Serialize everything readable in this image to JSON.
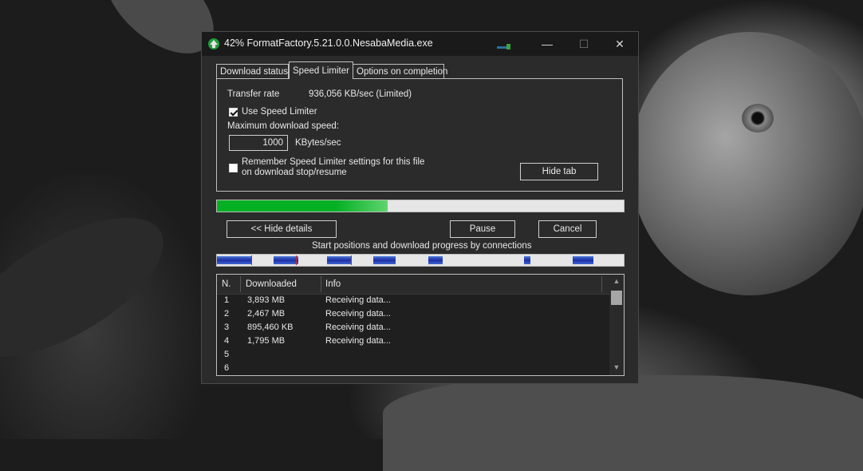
{
  "window": {
    "title": "42% FormatFactory.5.21.0.0.NesabaMedia.exe",
    "controls": {
      "minimize": "—",
      "maximize": "☐",
      "close": "✕"
    }
  },
  "tabs": [
    {
      "label": "Download status",
      "active": false
    },
    {
      "label": "Speed Limiter",
      "active": true
    },
    {
      "label": "Options on completion",
      "active": false
    }
  ],
  "speed_limiter": {
    "transfer_rate_label": "Transfer rate",
    "transfer_rate_value": "936,056  KB/sec  (Limited)",
    "use_limiter_label": "Use Speed Limiter",
    "use_limiter_checked": true,
    "max_speed_label": "Maximum download speed:",
    "max_speed_value": "1000",
    "max_speed_unit": "KBytes/sec",
    "remember_label_line1": "Remember Speed Limiter settings for this file",
    "remember_label_line2": "on download stop/resume",
    "remember_checked": false,
    "hide_tab_button": "Hide tab"
  },
  "progress": {
    "percent": 42,
    "color": "#06b025"
  },
  "buttons": {
    "hide_details": "<< Hide details",
    "pause": "Pause",
    "cancel": "Cancel"
  },
  "connections_title": "Start positions and download progress by connections",
  "connections_bar": {
    "segments": [
      [
        0.0,
        0.085
      ],
      [
        0.14,
        0.2
      ],
      [
        0.27,
        0.33
      ],
      [
        0.385,
        0.44
      ],
      [
        0.52,
        0.555
      ],
      [
        0.755,
        0.77
      ],
      [
        0.875,
        0.925
      ]
    ],
    "markers": [
      0.085,
      0.195,
      0.33
    ]
  },
  "list": {
    "headers": {
      "n": "N.",
      "downloaded": "Downloaded",
      "info": "Info"
    },
    "rows": [
      {
        "n": "1",
        "downloaded": "3,893  MB",
        "info": "Receiving data..."
      },
      {
        "n": "2",
        "downloaded": "2,467  MB",
        "info": "Receiving data..."
      },
      {
        "n": "3",
        "downloaded": "895,460  KB",
        "info": "Receiving data..."
      },
      {
        "n": "4",
        "downloaded": "1,795  MB",
        "info": "Receiving data..."
      },
      {
        "n": "5",
        "downloaded": "",
        "info": ""
      },
      {
        "n": "6",
        "downloaded": "",
        "info": ""
      }
    ]
  }
}
